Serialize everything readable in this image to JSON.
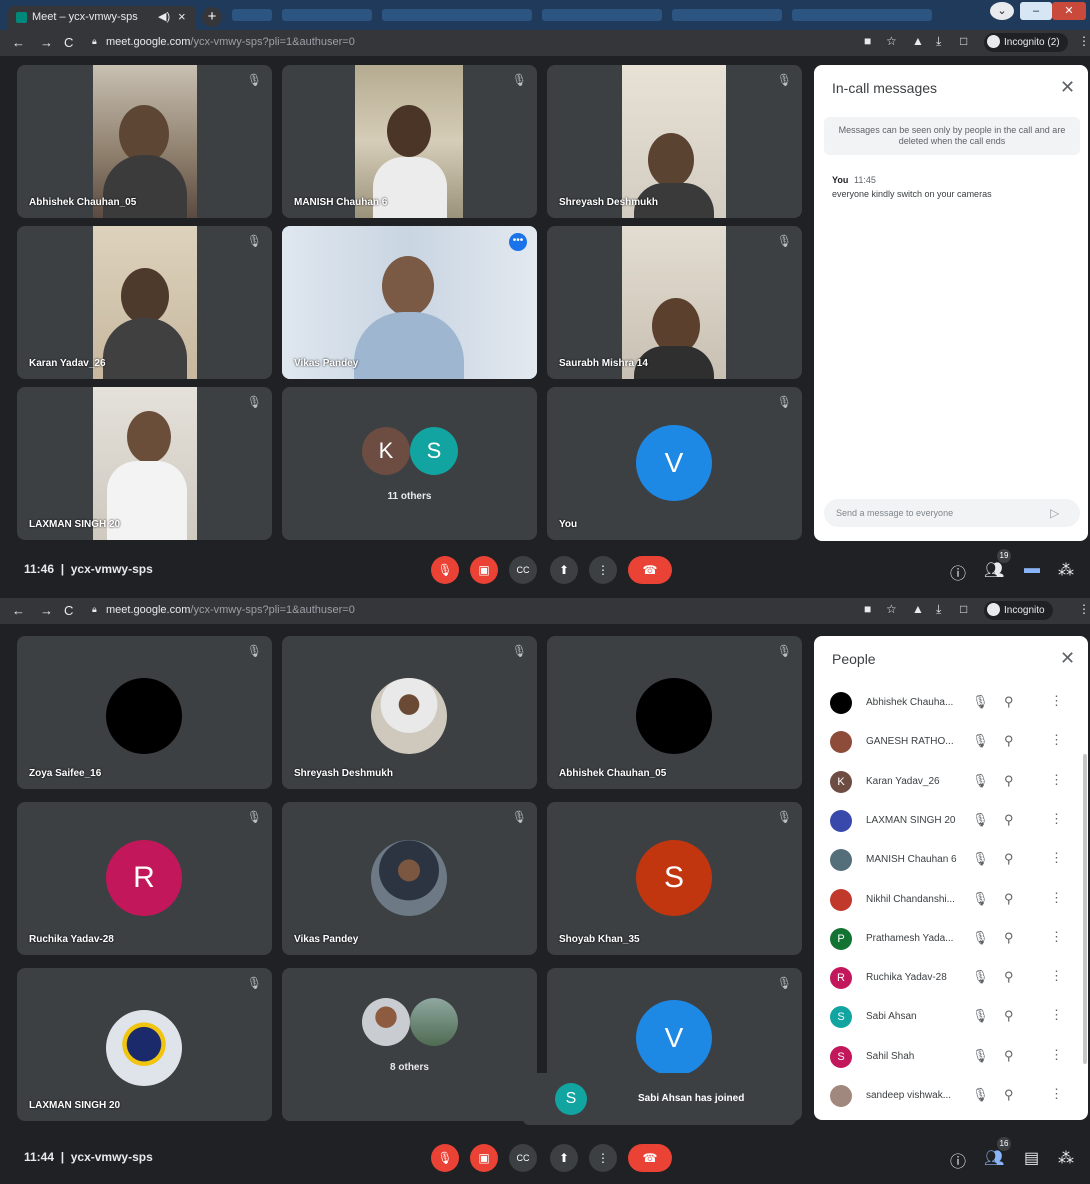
{
  "browser": {
    "tab_title": "Meet – ycx-vmwy-sps",
    "url_host": "meet.google.com",
    "url_path": "/ycx-vmwy-sps?pli=1&authuser=0",
    "incognito_top": "Incognito (2)",
    "incognito_bottom": "Incognito"
  },
  "top": {
    "time": "11:46",
    "meeting_code": "ycx-vmwy-sps",
    "people_count": "19",
    "tiles": [
      {
        "name": "Abhishek Chauhan_05"
      },
      {
        "name": "MANISH Chauhan 6"
      },
      {
        "name": "Shreyash Deshmukh"
      },
      {
        "name": "Karan Yadav_26"
      },
      {
        "name": "Vikas Pandey"
      },
      {
        "name": "Saurabh Mishra 14"
      },
      {
        "name": "LAXMAN SINGH 20"
      },
      {
        "name": "11 others",
        "initials": [
          "K",
          "S"
        ]
      },
      {
        "name": "You",
        "initial": "V"
      }
    ],
    "panel": {
      "title": "In-call messages",
      "info": "Messages can be seen only by people in the call and are deleted when the call ends",
      "message_sender": "You",
      "message_time": "11:45",
      "message_text": "everyone kindly switch on your cameras",
      "input_placeholder": "Send a message to everyone"
    }
  },
  "bottom": {
    "time": "11:44",
    "meeting_code": "ycx-vmwy-sps",
    "people_count": "16",
    "tiles": [
      {
        "name": "Zoya Saifee_16"
      },
      {
        "name": "Shreyash Deshmukh"
      },
      {
        "name": "Abhishek Chauhan_05"
      },
      {
        "name": "Ruchika Yadav-28",
        "initial": "R"
      },
      {
        "name": "Vikas Pandey"
      },
      {
        "name": "Shoyab Khan_35",
        "initial": "S"
      },
      {
        "name": "LAXMAN SINGH 20"
      },
      {
        "name": "8 others"
      },
      {
        "name": "",
        "initial": "V"
      }
    ],
    "toast": {
      "initial": "S",
      "text": "Sabi Ahsan has joined"
    },
    "panel": {
      "title": "People",
      "people": [
        {
          "name": "Abhishek Chauha...",
          "initial": "",
          "color": "#000000"
        },
        {
          "name": "GANESH RATHO...",
          "initial": "",
          "color": "#8d4c3a"
        },
        {
          "name": "Karan Yadav_26",
          "initial": "K",
          "color": "#6d4c41"
        },
        {
          "name": "LAXMAN SINGH 20",
          "initial": "",
          "color": "#3949ab"
        },
        {
          "name": "MANISH Chauhan 6",
          "initial": "",
          "color": "#546e7a"
        },
        {
          "name": "Nikhil Chandanshi...",
          "initial": "",
          "color": "#c0392b"
        },
        {
          "name": "Prathamesh Yada...",
          "initial": "P",
          "color": "#137333"
        },
        {
          "name": "Ruchika Yadav-28",
          "initial": "R",
          "color": "#c2185b"
        },
        {
          "name": "Sabi Ahsan",
          "initial": "S",
          "color": "#12a4a0"
        },
        {
          "name": "Sahil Shah",
          "initial": "S",
          "color": "#c2185b"
        },
        {
          "name": "sandeep vishwak...",
          "initial": "",
          "color": "#a1887f"
        }
      ]
    }
  },
  "colors": {
    "meet_red": "#ea4335",
    "accent_blue": "#1a73e8",
    "tile_bg": "#3c4043"
  }
}
